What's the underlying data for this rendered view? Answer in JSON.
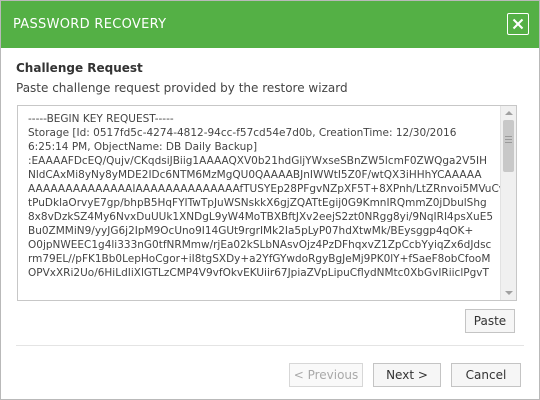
{
  "window": {
    "title": "PASSWORD RECOVERY",
    "close_icon": "close-icon"
  },
  "content": {
    "section_title": "Challenge Request",
    "section_description": "Paste challenge request provided by the restore wizard",
    "request_text": "-----BEGIN KEY REQUEST-----\nStorage [Id: 0517fd5c-4274-4812-94cc-f57cd54e7d0b, CreationTime: 12/30/2016\n6:25:14 PM, ObjectName: DB Daily Backup]\n:EAAAAFDcEQ/Qujv/CKqdsiJBiig1AAAAQXV0b21hdGljYWxseSBnZW5lcmF0ZWQga2V5IH\nNldCAxMi8yNy8yMDE2IDc6NTM6MzMgQU0QAAAABJnIWWtI5Z0F/wtQX3iHHhYCAAAAA\nAAAAAAAAAAAAAAIAAAAAAAAAAAAAAfTUSYEp28PFgvNZpXF5T+8XPnh/LtZRnvoi5MVuCv5\ntPuDklaOrvyE7gp/bhpB5HqFYITwTpJuWSNskkX6gjZQATtEgij0G9KmnIRQmmZ0jDbulShg\n8x8vDzkSZ4My6NvxDuUUk1XNDgL9yW4MoTBXBftJXv2eejS2zt0NRgg8yi/9NqIRI4psXuE5\nBu0ZMMiN9/yyJG6j2IpM9OcUno9I14GUt9rgrIMk2Ia5pLyP07hdXtwMk/BEysggp4qOK+\nO0jpNWEEC1g4li333nG0tfNRMmw/rjEa02kSLbNAsvOjz4PzDFhqxvZ1ZpCcbYyiqZx6dJdsc\nrm79EL//pFK1Bb0LepHoCgor+iI8tgSXDy+a2YfGYwdoRgyBgJeMj9PK0lY+fSaeF8obCfooM\nOPVxXRi2Uo/6HiLdIiXlGTLzCMP4V9vfOkvEKUiir67JpiaZVpLipuCflydNMtc0XbGvIRiiclPgvT"
  },
  "buttons": {
    "paste": "Paste",
    "previous": "< Previous",
    "next": "Next >",
    "cancel": "Cancel"
  },
  "colors": {
    "titlebar": "#54b045",
    "title_text": "#ffffff",
    "disabled_text": "#a9a9a9"
  },
  "icons": {
    "close": "close-icon",
    "scroll_up": "chevron-up-icon",
    "scroll_down": "chevron-down-icon"
  }
}
